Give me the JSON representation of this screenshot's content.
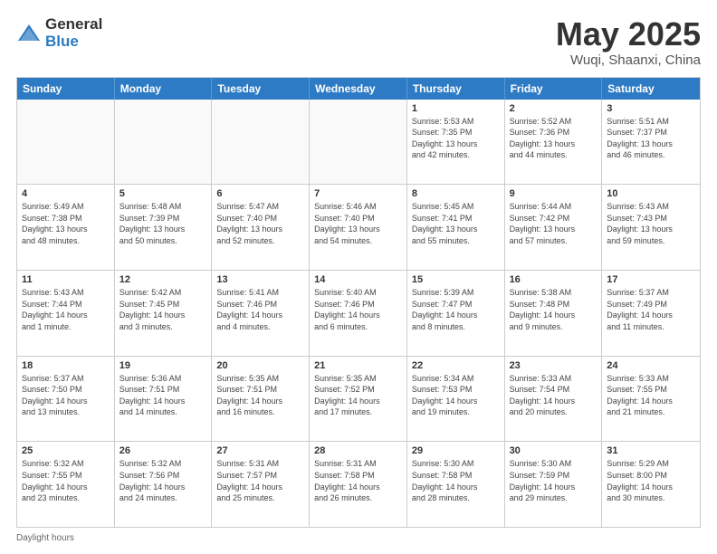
{
  "header": {
    "logo_general": "General",
    "logo_blue": "Blue",
    "title_month": "May 2025",
    "title_location": "Wuqi, Shaanxi, China"
  },
  "day_headers": [
    "Sunday",
    "Monday",
    "Tuesday",
    "Wednesday",
    "Thursday",
    "Friday",
    "Saturday"
  ],
  "footer_label": "Daylight hours",
  "weeks": [
    [
      {
        "day": "",
        "info": "",
        "empty": true
      },
      {
        "day": "",
        "info": "",
        "empty": true
      },
      {
        "day": "",
        "info": "",
        "empty": true
      },
      {
        "day": "",
        "info": "",
        "empty": true
      },
      {
        "day": "1",
        "info": "Sunrise: 5:53 AM\nSunset: 7:35 PM\nDaylight: 13 hours\nand 42 minutes."
      },
      {
        "day": "2",
        "info": "Sunrise: 5:52 AM\nSunset: 7:36 PM\nDaylight: 13 hours\nand 44 minutes."
      },
      {
        "day": "3",
        "info": "Sunrise: 5:51 AM\nSunset: 7:37 PM\nDaylight: 13 hours\nand 46 minutes."
      }
    ],
    [
      {
        "day": "4",
        "info": "Sunrise: 5:49 AM\nSunset: 7:38 PM\nDaylight: 13 hours\nand 48 minutes."
      },
      {
        "day": "5",
        "info": "Sunrise: 5:48 AM\nSunset: 7:39 PM\nDaylight: 13 hours\nand 50 minutes."
      },
      {
        "day": "6",
        "info": "Sunrise: 5:47 AM\nSunset: 7:40 PM\nDaylight: 13 hours\nand 52 minutes."
      },
      {
        "day": "7",
        "info": "Sunrise: 5:46 AM\nSunset: 7:40 PM\nDaylight: 13 hours\nand 54 minutes."
      },
      {
        "day": "8",
        "info": "Sunrise: 5:45 AM\nSunset: 7:41 PM\nDaylight: 13 hours\nand 55 minutes."
      },
      {
        "day": "9",
        "info": "Sunrise: 5:44 AM\nSunset: 7:42 PM\nDaylight: 13 hours\nand 57 minutes."
      },
      {
        "day": "10",
        "info": "Sunrise: 5:43 AM\nSunset: 7:43 PM\nDaylight: 13 hours\nand 59 minutes."
      }
    ],
    [
      {
        "day": "11",
        "info": "Sunrise: 5:43 AM\nSunset: 7:44 PM\nDaylight: 14 hours\nand 1 minute."
      },
      {
        "day": "12",
        "info": "Sunrise: 5:42 AM\nSunset: 7:45 PM\nDaylight: 14 hours\nand 3 minutes."
      },
      {
        "day": "13",
        "info": "Sunrise: 5:41 AM\nSunset: 7:46 PM\nDaylight: 14 hours\nand 4 minutes."
      },
      {
        "day": "14",
        "info": "Sunrise: 5:40 AM\nSunset: 7:46 PM\nDaylight: 14 hours\nand 6 minutes."
      },
      {
        "day": "15",
        "info": "Sunrise: 5:39 AM\nSunset: 7:47 PM\nDaylight: 14 hours\nand 8 minutes."
      },
      {
        "day": "16",
        "info": "Sunrise: 5:38 AM\nSunset: 7:48 PM\nDaylight: 14 hours\nand 9 minutes."
      },
      {
        "day": "17",
        "info": "Sunrise: 5:37 AM\nSunset: 7:49 PM\nDaylight: 14 hours\nand 11 minutes."
      }
    ],
    [
      {
        "day": "18",
        "info": "Sunrise: 5:37 AM\nSunset: 7:50 PM\nDaylight: 14 hours\nand 13 minutes."
      },
      {
        "day": "19",
        "info": "Sunrise: 5:36 AM\nSunset: 7:51 PM\nDaylight: 14 hours\nand 14 minutes."
      },
      {
        "day": "20",
        "info": "Sunrise: 5:35 AM\nSunset: 7:51 PM\nDaylight: 14 hours\nand 16 minutes."
      },
      {
        "day": "21",
        "info": "Sunrise: 5:35 AM\nSunset: 7:52 PM\nDaylight: 14 hours\nand 17 minutes."
      },
      {
        "day": "22",
        "info": "Sunrise: 5:34 AM\nSunset: 7:53 PM\nDaylight: 14 hours\nand 19 minutes."
      },
      {
        "day": "23",
        "info": "Sunrise: 5:33 AM\nSunset: 7:54 PM\nDaylight: 14 hours\nand 20 minutes."
      },
      {
        "day": "24",
        "info": "Sunrise: 5:33 AM\nSunset: 7:55 PM\nDaylight: 14 hours\nand 21 minutes."
      }
    ],
    [
      {
        "day": "25",
        "info": "Sunrise: 5:32 AM\nSunset: 7:55 PM\nDaylight: 14 hours\nand 23 minutes."
      },
      {
        "day": "26",
        "info": "Sunrise: 5:32 AM\nSunset: 7:56 PM\nDaylight: 14 hours\nand 24 minutes."
      },
      {
        "day": "27",
        "info": "Sunrise: 5:31 AM\nSunset: 7:57 PM\nDaylight: 14 hours\nand 25 minutes."
      },
      {
        "day": "28",
        "info": "Sunrise: 5:31 AM\nSunset: 7:58 PM\nDaylight: 14 hours\nand 26 minutes."
      },
      {
        "day": "29",
        "info": "Sunrise: 5:30 AM\nSunset: 7:58 PM\nDaylight: 14 hours\nand 28 minutes."
      },
      {
        "day": "30",
        "info": "Sunrise: 5:30 AM\nSunset: 7:59 PM\nDaylight: 14 hours\nand 29 minutes."
      },
      {
        "day": "31",
        "info": "Sunrise: 5:29 AM\nSunset: 8:00 PM\nDaylight: 14 hours\nand 30 minutes."
      }
    ]
  ]
}
